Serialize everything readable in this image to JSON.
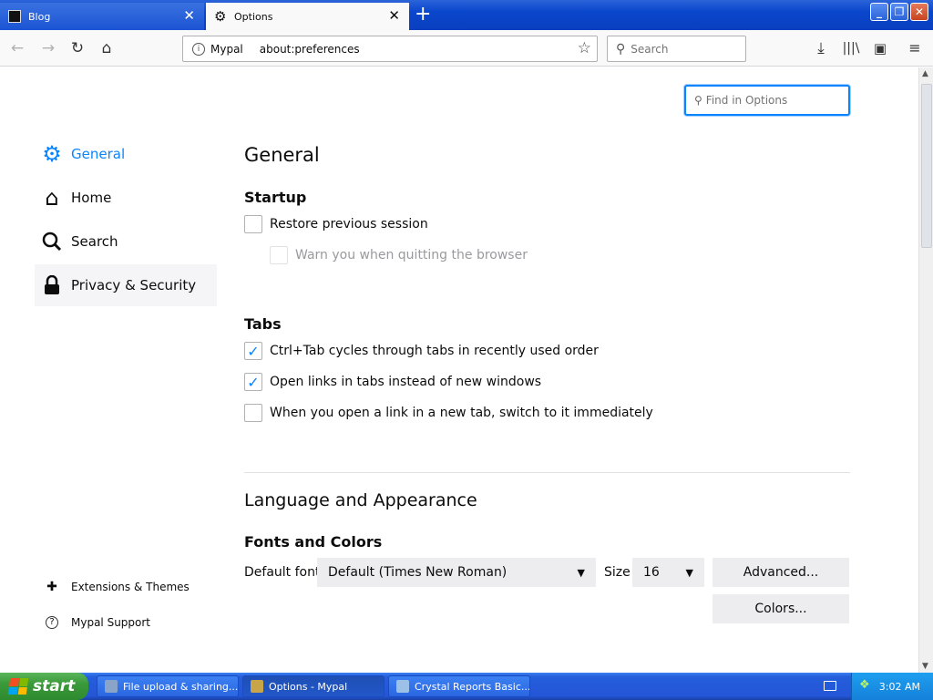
{
  "tabs": [
    {
      "label": "Blog",
      "active": false
    },
    {
      "label": "Options",
      "active": true
    }
  ],
  "urlbar": {
    "identity": "Mypal",
    "url": "about:preferences"
  },
  "searchbar": {
    "placeholder": "Search"
  },
  "find": {
    "placeholder": "Find in Options"
  },
  "sidebar": {
    "categories": [
      {
        "label": "General",
        "icon": "gear-icon",
        "selected": true
      },
      {
        "label": "Home",
        "icon": "home-icon"
      },
      {
        "label": "Search",
        "icon": "search-icon"
      },
      {
        "label": "Privacy & Security",
        "icon": "lock-icon"
      }
    ],
    "footer": [
      {
        "label": "Extensions & Themes",
        "icon": "puzzle-icon"
      },
      {
        "label": "Mypal Support",
        "icon": "help-icon"
      }
    ]
  },
  "general": {
    "heading": "General",
    "startup": {
      "heading": "Startup",
      "restore": {
        "label": "Restore previous session",
        "checked": false
      },
      "warn": {
        "label": "Warn you when quitting the browser",
        "checked": false,
        "disabled": true
      }
    },
    "tabs": {
      "heading": "Tabs",
      "ctrl_tab": {
        "label": "Ctrl+Tab cycles through tabs in recently used order",
        "checked": true
      },
      "open_links": {
        "label": "Open links in tabs instead of new windows",
        "checked": true
      },
      "switch_to": {
        "label": "When you open a link in a new tab, switch to it immediately",
        "checked": false
      }
    }
  },
  "language": {
    "heading": "Language and Appearance",
    "fonts": {
      "heading": "Fonts and Colors",
      "default_font_label": "Default font",
      "default_font_value": "Default (Times New Roman)",
      "size_label": "Size",
      "size_value": "16",
      "advanced_button": "Advanced...",
      "colors_button": "Colors..."
    }
  },
  "taskbar": {
    "start": "start",
    "items": [
      {
        "label": "File upload & sharing....",
        "active": false
      },
      {
        "label": "Options - Mypal",
        "active": true
      },
      {
        "label": "Crystal Reports Basic...",
        "active": false
      }
    ],
    "clock": "3:02 AM"
  },
  "colors": {
    "accent": "#0a84ff",
    "xp_blue": "#245edb",
    "start_green": "#3a9a3a"
  }
}
